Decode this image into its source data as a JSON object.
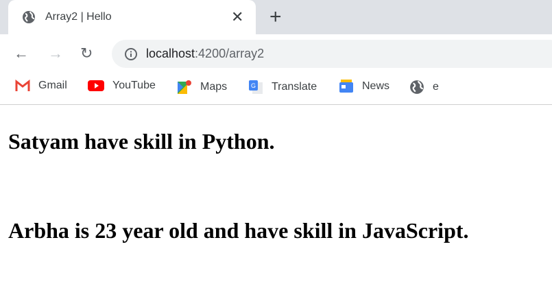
{
  "tab": {
    "title": "Array2 | Hello",
    "close": "✕",
    "new_tab": "+"
  },
  "toolbar": {
    "back": "←",
    "forward": "→",
    "reload": "↻",
    "url_host": "localhost",
    "url_path": ":4200/array2"
  },
  "bookmarks": [
    {
      "label": "Gmail",
      "icon": "gmail-icon",
      "color": "#ea4335"
    },
    {
      "label": "YouTube",
      "icon": "youtube-icon",
      "color": "#ff0000"
    },
    {
      "label": "Maps",
      "icon": "maps-icon",
      "color": "#34a853"
    },
    {
      "label": "Translate",
      "icon": "translate-icon",
      "color": "#4285f4"
    },
    {
      "label": "News",
      "icon": "news-icon",
      "color": "#4285f4"
    },
    {
      "label": "e",
      "icon": "globe-icon",
      "color": "#5f6368"
    }
  ],
  "content": {
    "line1": "Satyam have skill in Python.",
    "line2": "Arbha is 23 year old and have skill in JavaScript."
  }
}
